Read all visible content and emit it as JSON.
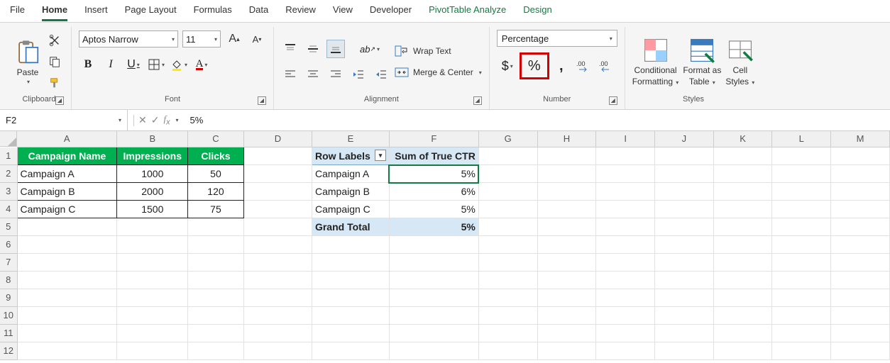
{
  "tabs": {
    "file": "File",
    "home": "Home",
    "insert": "Insert",
    "page_layout": "Page Layout",
    "formulas": "Formulas",
    "data": "Data",
    "review": "Review",
    "view": "View",
    "developer": "Developer",
    "pt_analyze": "PivotTable Analyze",
    "design": "Design"
  },
  "ribbon": {
    "clipboard": {
      "label": "Clipboard",
      "paste": "Paste"
    },
    "font": {
      "label": "Font",
      "name": "Aptos Narrow",
      "size": "11",
      "bold": "B",
      "italic": "I",
      "underline": "U"
    },
    "alignment": {
      "label": "Alignment",
      "wrap": "Wrap Text",
      "merge": "Merge & Center"
    },
    "number": {
      "label": "Number",
      "format": "Percentage",
      "currency": "$",
      "percent": "%",
      "comma": ","
    },
    "styles": {
      "label": "Styles",
      "cond": "Conditional",
      "cond2": "Formatting",
      "fmt": "Format as",
      "fmt2": "Table",
      "cell": "Cell",
      "cell2": "Styles"
    }
  },
  "formula_bar": {
    "name": "F2",
    "value": "5%"
  },
  "cols": [
    "A",
    "B",
    "C",
    "D",
    "E",
    "F",
    "G",
    "H",
    "I",
    "J",
    "K",
    "L",
    "M"
  ],
  "rows": [
    "1",
    "2",
    "3",
    "4",
    "5",
    "6",
    "7",
    "8",
    "9",
    "10",
    "11",
    "12"
  ],
  "table": {
    "headers": {
      "campaign": "Campaign Name",
      "impressions": "Impressions",
      "clicks": "Clicks"
    },
    "rows": [
      {
        "name": "Campaign A",
        "impressions": "1000",
        "clicks": "50"
      },
      {
        "name": "Campaign B",
        "impressions": "2000",
        "clicks": "120"
      },
      {
        "name": "Campaign C",
        "impressions": "1500",
        "clicks": "75"
      }
    ]
  },
  "pivot": {
    "row_label_hdr": "Row Labels",
    "value_hdr": "Sum of True CTR",
    "rows": [
      {
        "label": "Campaign A",
        "value": "5%"
      },
      {
        "label": "Campaign B",
        "value": "6%"
      },
      {
        "label": "Campaign C",
        "value": "5%"
      }
    ],
    "total_label": "Grand Total",
    "total_value": "5%"
  }
}
